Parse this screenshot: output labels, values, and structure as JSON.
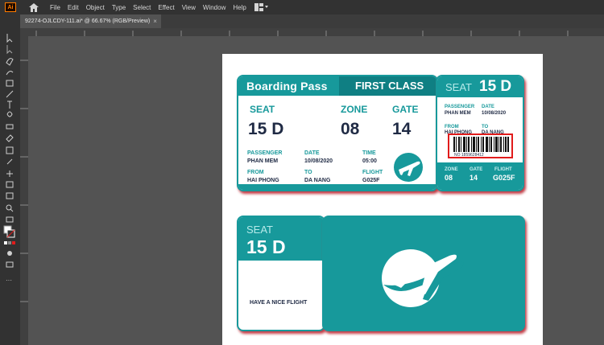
{
  "app": {
    "logo_text": "Ai",
    "menu": [
      "File",
      "Edit",
      "Object",
      "Type",
      "Select",
      "Effect",
      "View",
      "Window",
      "Help"
    ]
  },
  "document_tab": {
    "title": "92274-OJLCDY-111.ai* @ 66.67% (RGB/Preview)",
    "close": "×"
  },
  "ticket1": {
    "header_title": "Boarding Pass",
    "header_class": "FIRST CLASS",
    "seat_label": "SEAT",
    "seat_value": "15 D",
    "zone_label": "ZONE",
    "zone_value": "08",
    "gate_label": "GATE",
    "gate_value": "14",
    "passenger_label": "PASSENGER",
    "passenger_value": "PHAN MEM",
    "date_label": "DATE",
    "date_value": "10/08/2020",
    "time_label": "TIME",
    "time_value": "05:00",
    "from_label": "FROM",
    "from_value": "HAI PHONG",
    "to_label": "TO",
    "to_value": "DA NANG",
    "flight_label": "FLIGHT",
    "flight_value": "G025F"
  },
  "stub1": {
    "seat_label": "SEAT",
    "seat_value": "15 D",
    "passenger_label": "PASSENGER",
    "passenger_value": "PHAN MEM",
    "date_label": "DATE",
    "date_value": "10/08/2020",
    "from_label": "FROM",
    "from_value": "HAI PHONG",
    "to_label": "TO",
    "to_value": "DA NANG",
    "barcode_number": "NO 1859628412",
    "zone_label": "ZONE",
    "zone_value": "08",
    "gate_label": "GATE",
    "gate_value": "14",
    "flight_label": "FLIGHT",
    "flight_value": "G025F"
  },
  "ticket2": {
    "seat_label": "SEAT",
    "seat_value": "15 D",
    "message": "HAVE A NICE FLIGHT"
  },
  "colors": {
    "teal": "#17999b",
    "dark_teal": "#0f7f83",
    "navy": "#1f2a44",
    "highlight": "#e11b1b"
  }
}
